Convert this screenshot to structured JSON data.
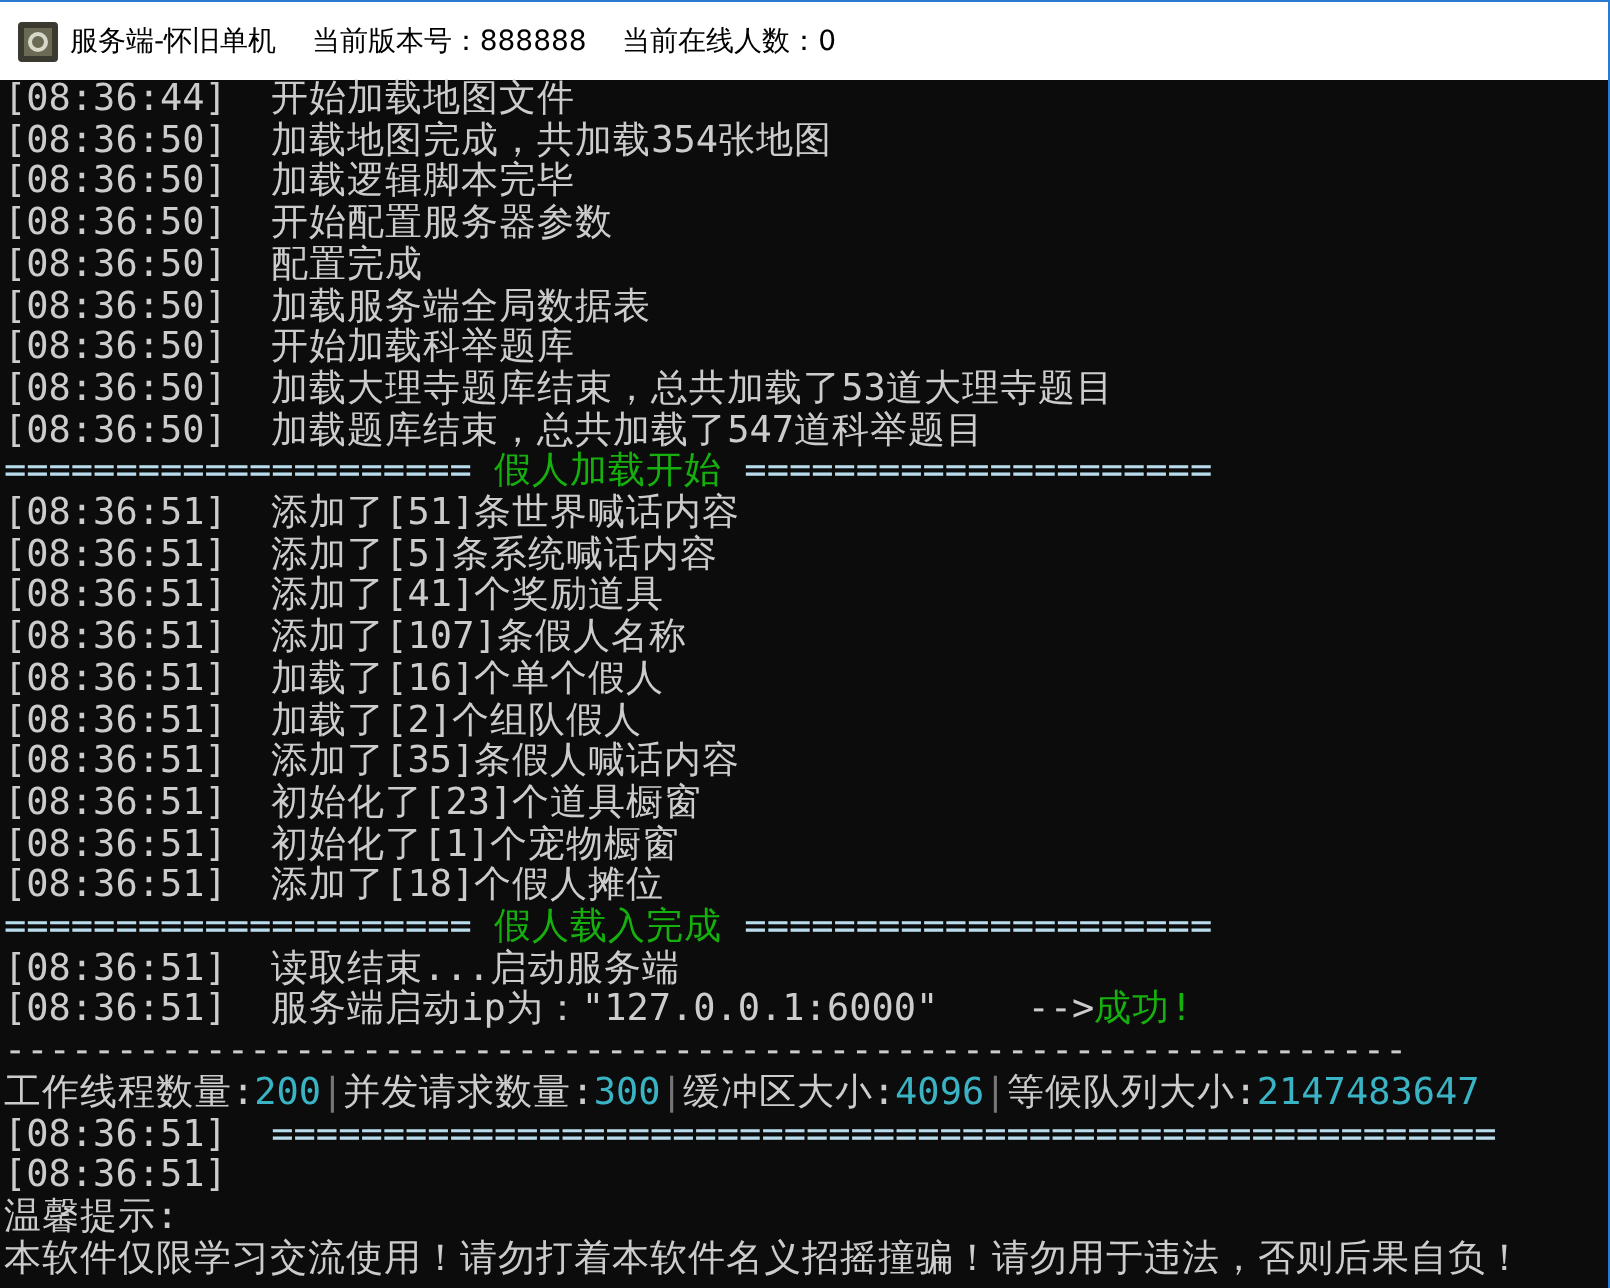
{
  "window": {
    "title": "服务端-怀旧单机    当前版本号：888888    当前在线人数：0"
  },
  "console": {
    "lines": [
      [
        {
          "kind": "text",
          "text": "[08:36:44]  开始加载地图文件"
        }
      ],
      [
        {
          "kind": "text",
          "text": "[08:36:50]  加载地图完成，共加载354张地图"
        }
      ],
      [
        {
          "kind": "text",
          "text": "[08:36:50]  加载逻辑脚本完毕"
        }
      ],
      [
        {
          "kind": "text",
          "text": "[08:36:50]  开始配置服务器参数"
        }
      ],
      [
        {
          "kind": "text",
          "text": "[08:36:50]  配置完成"
        }
      ],
      [
        {
          "kind": "text",
          "text": "[08:36:50]  加载服务端全局数据表"
        }
      ],
      [
        {
          "kind": "text",
          "text": "[08:36:50]  开始加载科举题库"
        }
      ],
      [
        {
          "kind": "text",
          "text": "[08:36:50]  加载大理寺题库结束，总共加载了53道大理寺题目"
        }
      ],
      [
        {
          "kind": "text",
          "text": "[08:36:50]  加载题库结束，总共加载了547道科举题目"
        }
      ],
      [
        {
          "kind": "rule",
          "text": "===================== "
        },
        {
          "kind": "success",
          "text": "假人加载开始"
        },
        {
          "kind": "rule",
          "text": " ====================="
        }
      ],
      [
        {
          "kind": "text",
          "text": "[08:36:51]  添加了[51]条世界喊话内容"
        }
      ],
      [
        {
          "kind": "text",
          "text": "[08:36:51]  添加了[5]条系统喊话内容"
        }
      ],
      [
        {
          "kind": "text",
          "text": "[08:36:51]  添加了[41]个奖励道具"
        }
      ],
      [
        {
          "kind": "text",
          "text": "[08:36:51]  添加了[107]条假人名称"
        }
      ],
      [
        {
          "kind": "text",
          "text": "[08:36:51]  加载了[16]个单个假人"
        }
      ],
      [
        {
          "kind": "text",
          "text": "[08:36:51]  加载了[2]个组队假人"
        }
      ],
      [
        {
          "kind": "text",
          "text": "[08:36:51]  添加了[35]条假人喊话内容"
        }
      ],
      [
        {
          "kind": "text",
          "text": "[08:36:51]  初始化了[23]个道具橱窗"
        }
      ],
      [
        {
          "kind": "text",
          "text": "[08:36:51]  初始化了[1]个宠物橱窗"
        }
      ],
      [
        {
          "kind": "text",
          "text": "[08:36:51]  添加了[18]个假人摊位"
        }
      ],
      [
        {
          "kind": "rule",
          "text": "===================== "
        },
        {
          "kind": "success",
          "text": "假人载入完成"
        },
        {
          "kind": "rule",
          "text": " ====================="
        }
      ],
      [
        {
          "kind": "text",
          "text": "[08:36:51]  读取结束...启动服务端"
        }
      ],
      [
        {
          "kind": "text",
          "text": "[08:36:51]  服务端启动ip为：\"127.0.0.1:6000\"    -->"
        },
        {
          "kind": "success",
          "text": "成功!"
        }
      ],
      [
        {
          "kind": "text",
          "text": "---------------------------------------------------------------"
        }
      ],
      [
        {
          "kind": "text",
          "text": "工作线程数量:"
        },
        {
          "kind": "value",
          "text": "200"
        },
        {
          "kind": "dim",
          "text": "|"
        },
        {
          "kind": "text",
          "text": "并发请求数量:"
        },
        {
          "kind": "value",
          "text": "300"
        },
        {
          "kind": "dim",
          "text": "|"
        },
        {
          "kind": "text",
          "text": "缓冲区大小:"
        },
        {
          "kind": "value",
          "text": "4096"
        },
        {
          "kind": "dim",
          "text": "|"
        },
        {
          "kind": "text",
          "text": "等候队列大小:"
        },
        {
          "kind": "value",
          "text": "2147483647"
        }
      ],
      [
        {
          "kind": "text",
          "text": "[08:36:51]  "
        },
        {
          "kind": "rule",
          "text": "======================================================="
        }
      ],
      [
        {
          "kind": "text",
          "text": "[08:36:51]"
        }
      ],
      [
        {
          "kind": "text",
          "text": "温馨提示:"
        }
      ],
      [
        {
          "kind": "text",
          "text": "本软件仅限学习交流使用！请勿打着本软件名义招摇撞骗！请勿用于违法，否则后果自负！"
        }
      ]
    ]
  }
}
